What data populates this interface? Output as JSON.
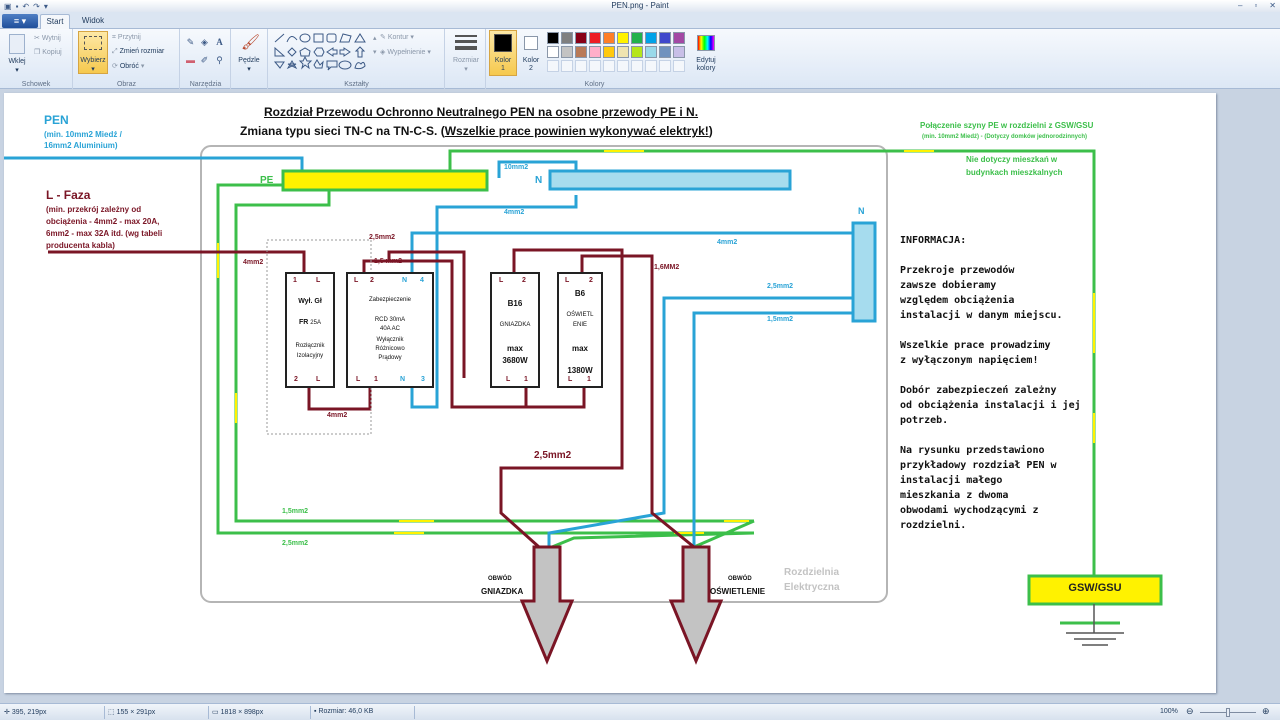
{
  "window": {
    "title": "PEN.png - Paint"
  },
  "tabs": [
    {
      "label": "Start"
    },
    {
      "label": "Widok"
    }
  ],
  "ribbon": {
    "schowek": {
      "label": "Schowek",
      "paste": "Wklej",
      "cut": "Wytnij",
      "copy": "Kopiuj"
    },
    "obraz": {
      "label": "Obraz",
      "select": "Wybierz",
      "crop": "Przytnij",
      "resize": "Zmień rozmiar",
      "rotate": "Obróć"
    },
    "narzedzia": {
      "label": "Narzędzia"
    },
    "brushes": {
      "label": "Pędzle"
    },
    "ksztalty": {
      "label": "Kształty",
      "outline": "Kontur",
      "fill": "Wypełnienie"
    },
    "size": {
      "label": "Rozmiar"
    },
    "kolory": {
      "label": "Kolory",
      "color1": "Kolor\n1",
      "color1_a": "Kolor",
      "color1_b": "1",
      "color2_a": "Kolor",
      "color2_b": "2",
      "edit_a": "Edytuj",
      "edit_b": "kolory"
    },
    "palette": [
      "#000000",
      "#7f7f7f",
      "#880015",
      "#ed1c24",
      "#ff7f27",
      "#fff200",
      "#22b14c",
      "#00a2e8",
      "#3f48cc",
      "#a349a4",
      "#ffffff",
      "#c3c3c3",
      "#b97a57",
      "#ffaec9",
      "#ffc90e",
      "#efe4b0",
      "#b5e61d",
      "#99d9ea",
      "#7092be",
      "#c8bfe7"
    ]
  },
  "diagram": {
    "title1": "Rozdział Przewodu Ochronno Neutralnego PEN na osobne przewody PE i N.",
    "title2a": "Zmiana typu sieci TN-C na TN-C-S. (",
    "title2b": "Wszelkie prace powinien wykonywać elektryk!",
    "title2c": ")",
    "pen": "PEN",
    "pen_sub1": "(min. 10mm2 Miedź /",
    "pen_sub2": "16mm2 Aluminium)",
    "faza": "L - Faza",
    "faza_sub1": "(min. przekrój zależny od",
    "faza_sub2": "obciążenia - 4mm2 - max 20A,",
    "faza_sub3": "6mm2 - max 32A itd. (wg tabeli",
    "faza_sub4": "producenta kabla)",
    "pe_label": "PE",
    "n_label": "N",
    "n_label2": "N",
    "w10": "10mm2",
    "w4a": "4mm2",
    "w4b": "4mm2",
    "w4c": "4mm2",
    "w4d": "4mm2",
    "w25a": "2,5mm2",
    "w15a": "1,5 mm2",
    "w16": "1,6MM2",
    "w25b": "2,5mm2",
    "w15b": "1,5mm2",
    "w25c": "2,5mm2",
    "w15c": "1,5mm2",
    "w25d": "2,5mm2",
    "gsw_title": "Połączenie szyny PE w rozdzielni z GSW/GSU",
    "gsw_sub": "(min. 10mm2 Miedź) - (Dotyczy domków jednorodzinnych)",
    "gsw_note1": "Nie dotyczy mieszkań w",
    "gsw_note2": "budynkach mieszkalnych",
    "gsw_box": "GSW/GSU",
    "mod1": {
      "t1": "1",
      "t2": "L",
      "l1": "Wył. Gł",
      "l2": "FR",
      "l2b": "25A",
      "l3": "Rozłącznik",
      "l4": "Izolacyjny",
      "b1": "2",
      "b2": "L"
    },
    "mod2": {
      "t1": "L",
      "t2": "2",
      "t3": "N",
      "t4": "4",
      "l1": "Zabezpieczenie",
      "l2": "RCD 30mA",
      "l3": "40A AC",
      "l4": "Wyłącznik",
      "l5": "Różnicowo",
      "l6": "Prądowy",
      "b1": "L",
      "b2": "1",
      "b3": "N",
      "b4": "3"
    },
    "mod3": {
      "t1": "L",
      "t2": "2",
      "l1": "B16",
      "l2": "GNIAZDKA",
      "l3": "max",
      "l4": "3680W",
      "b1": "L",
      "b2": "1"
    },
    "mod4": {
      "t1": "L",
      "t2": "2",
      "l1": "B6",
      "l2": "OŚWIETL",
      "l3": "ENIE",
      "l4": "max",
      "l5": "1380W",
      "b1": "L",
      "b2": "1"
    },
    "info_title": "INFORMACJA:",
    "info1a": "Przekroje przewodów",
    "info1b": "zawsze dobieramy",
    "info1c": "względem obciążenia",
    "info1d": "instalacji w danym miejscu.",
    "info2a": "Wszelkie prace prowadzimy",
    "info2b": "z wyłączonym napięciem!",
    "info3a": "Dobór zabezpieczeń zależny",
    "info3b": "od obciążenia instalacji i jej",
    "info3c": "potrzeb.",
    "info4a": "Na rysunku przedstawiono",
    "info4b": "przykładowy rozdział PEN w",
    "info4c": "instalacji małego",
    "info4d": "mieszkania z dwoma",
    "info4e": "obwodami wychodzącymi z",
    "info4f": "rozdzielni.",
    "obwod1a": "OBWÓD",
    "obwod1b": "GNIAZDKA",
    "obwod2a": "OBWÓD",
    "obwod2b": "OŚWIETLENIE",
    "rozdzielnia1": "Rozdzielnia",
    "rozdzielnia2": "Elektryczna"
  },
  "status": {
    "cursor": "395, 219px",
    "selection": "155 × 291px",
    "imagesize": "1818 × 898px",
    "filesize": "Rozmiar: 46,0 KB",
    "zoom": "100%"
  }
}
